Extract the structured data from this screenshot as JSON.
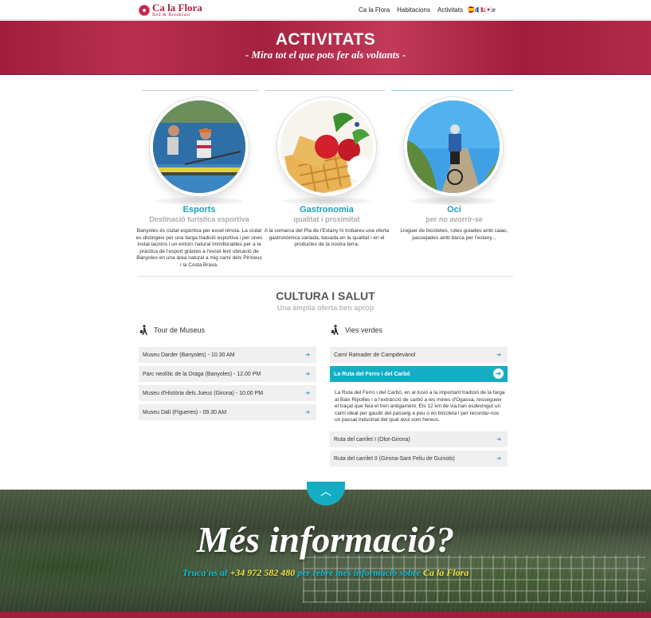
{
  "brand": {
    "title": "Ca la Flora",
    "subtitle": "Bed & Breakfast"
  },
  "nav": {
    "items": [
      "Ca la Flora",
      "Habitacions",
      "Activitats",
      "Contacte"
    ]
  },
  "languages": [
    "es-flag-icon",
    "fr-flag-icon",
    "en-flag-icon"
  ],
  "hero": {
    "title": "ACTIVITATS",
    "subtitle": "- Mira tot el que pots fer als voltants -"
  },
  "activities": [
    {
      "title": "Esports",
      "subtitle": "Destinació turística esportiva",
      "description": "Banyoles és ciutat esportiva per excel·lència. La ciutat es distingeix per una llarga tradició esportiva i per unes instal·lacions i un entorn natural immillorables per a la pràctica de l'esport gràcies a l'excel·lent ubicació de Banyoles en una àrea natural a mig camí dels Pirineus i la Costa Brava."
    },
    {
      "title": "Gastronomia",
      "subtitle": "qualitat i proximitat",
      "description": "A la comarca del Pla de l'Estany hi trobareu una oferta gastronòmica variada, basada en la qualitat i en el productes de la nostra terra."
    },
    {
      "title": "Oci",
      "subtitle": "per no avorrir-se",
      "description": "Lloguer de bicicletes, rutes guiades amb caiac, passejades amb barca per l'estany..."
    }
  ],
  "culture": {
    "title": "CULTURA I SALUT",
    "subtitle": "Una àmplia oferta ben aprop",
    "museums": {
      "heading": "Tour de Museus",
      "items": [
        "Museu Darder (Banyoles) - 10.30 AM",
        "Parc neolític de la Draga (Banyoles) - 12.00 PM",
        "Museu d'Història dels Jueus (Girona) - 10.00 PM",
        "Museu Dalí (Figueres) - 09.30 AM"
      ]
    },
    "greenways": {
      "heading": "Vies verdes",
      "items": [
        "Camí Ramader de Campdevànol",
        "La Ruta del Ferro i del Carbó",
        "Ruta del carrilet I (Olot-Girona)",
        "Ruta del carrilet II (Girona-Sant Feliu de Guíxols)"
      ],
      "active_index": 1,
      "active_description": "La Ruta del Ferro i del Carbó, en al·lusió a la important tradició de la farga al Baix Ripollès i a l'extracció de carbó a les mines d'Ogassa, ressegueix el traçat que feia el tren antigament. Els 12 km de via han esdevingut un camí ideal per gaudir del passeig a peu o en bicicleta i per recordar-nos un passat industrial del qual avui som hereus."
    }
  },
  "footer": {
    "title": "Més informació?",
    "line_prefix": "Truca'ns al ",
    "phone": "+34 972 582 480",
    "line_middle": " per rebre més informació sobre ",
    "brand": "Ca la Flora",
    "scroll_up_icon": "chevron-up-icon"
  }
}
